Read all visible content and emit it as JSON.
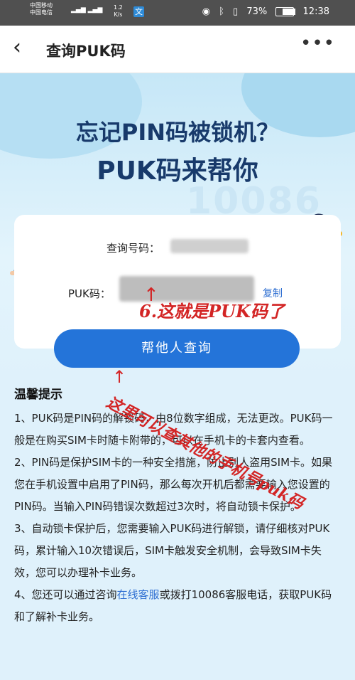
{
  "status_bar": {
    "carrier1": "中国移动",
    "carrier2": "中国电信",
    "speed": "1.2",
    "speed_unit": "K/s",
    "app_icon": "文",
    "battery": "73%",
    "time": "12:38"
  },
  "navbar": {
    "title": "查询PUK码"
  },
  "banner": {
    "headline1": "忘记PIN码被锁机？",
    "headline2": "PUK码来帮你",
    "watermark": "10086"
  },
  "card": {
    "query_label": "查询号码：",
    "puk_label": "PUK码：",
    "copy_label": "复制"
  },
  "button": {
    "label": "帮他人查询"
  },
  "tips": {
    "title": "温馨提示",
    "items": [
      "1、PUK码是PIN码的解锁码，由8位数字组成，无法更改。PUK码一般是在购买SIM卡时随卡附带的，可以在手机卡的卡套内查看。",
      "2、PIN码是保护SIM卡的一种安全措施，防止别人盗用SIM卡。如果您在手机设置中启用了PIN码，那么每次开机后都需要输入您设置的PIN码。当输入PIN码错误次数超过3次时，将自动锁卡保护。",
      "3、自动锁卡保护后，您需要输入PUK码进行解锁，请仔细核对PUK码，累计输入10次错误后，SIM卡触发安全机制，会导致SIM卡失效，您可以办理补卡业务。"
    ],
    "item4_prefix": "4、您还可以通过咨询",
    "item4_link": "在线客服",
    "item4_suffix": "或拨打10086客服电话，获取PUK码和了解补卡业务。"
  },
  "annotations": {
    "a1": "6.这就是PUK码了",
    "a2": "这里可以查其他的手机号puk码"
  },
  "colors": {
    "primary": "#2474d9",
    "headline": "#183a6b",
    "annotation": "#d32525"
  }
}
